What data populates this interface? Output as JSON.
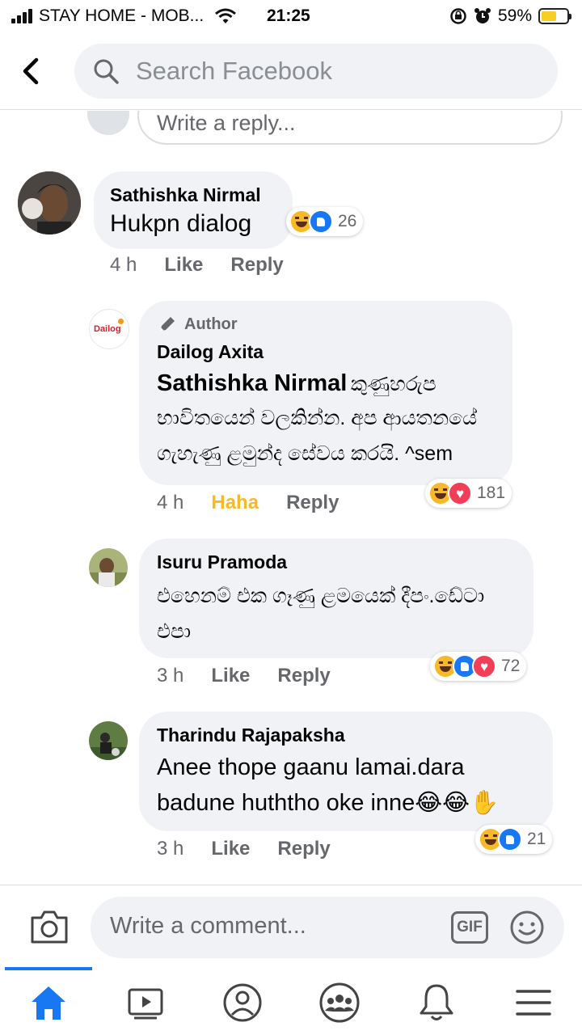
{
  "status_bar": {
    "carrier": "STAY HOME - MOB...",
    "time": "21:25",
    "battery": "59%",
    "battery_level": 0.59,
    "battery_color": "#f5cf21"
  },
  "header": {
    "back_icon": "chevron-left-icon",
    "search_placeholder": "Search Facebook"
  },
  "reply_input_placeholder": "Write a reply...",
  "comments": [
    {
      "name": "Sathishka Nirmal",
      "text": "Hukpn dialog",
      "time": "4 h",
      "action1": "Like",
      "action2": "Reply",
      "reactions": [
        "haha",
        "like"
      ],
      "reaction_count": "26"
    },
    {
      "author_badge": "Author",
      "name": "Dailog Axita",
      "avatar_text": "Dailog",
      "mention": "Sathishka Nirmal",
      "text_line1": "කුණුහරුප",
      "text_line2": "භාවිතයෙන් වලකින්න. අප ආයතනයේ",
      "text_line3": "ගැහැණු ළමුන්ද සේවය කරයි. ^sem",
      "time": "4 h",
      "action1": "Haha",
      "action2": "Reply",
      "reactions": [
        "haha",
        "love"
      ],
      "reaction_count": "181"
    },
    {
      "name": "Isuru Pramoda",
      "text_line1": "එහෙනම් එක ගෑණු ළමයෙක් දීපං.ඩේටා",
      "text_line2": "එපා",
      "time": "3 h",
      "action1": "Like",
      "action2": "Reply",
      "reactions": [
        "haha",
        "like",
        "love"
      ],
      "reaction_count": "72"
    },
    {
      "name": "Tharindu Rajapaksha",
      "text_line1": "Anee thope gaanu lamai.dara",
      "text_line2": "badune huththo oke inne😂😂✋",
      "time": "3 h",
      "action1": "Like",
      "action2": "Reply",
      "reactions": [
        "haha",
        "like"
      ],
      "reaction_count": "21"
    }
  ],
  "composer": {
    "placeholder": "Write a comment...",
    "gif_label": "GIF"
  },
  "nav": {
    "items": [
      "home-icon",
      "watch-icon",
      "profile-icon",
      "groups-icon",
      "notifications-icon",
      "menu-icon"
    ],
    "active": "home-icon",
    "accent": "#1877f2"
  }
}
